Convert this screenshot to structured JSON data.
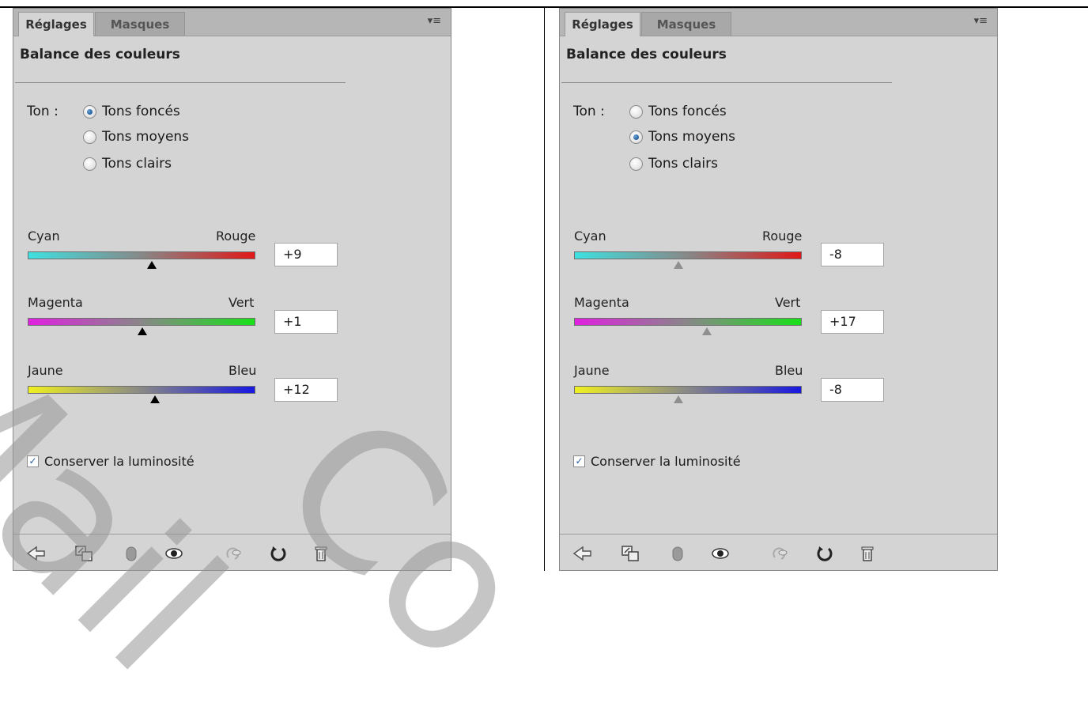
{
  "panels": [
    {
      "tabs": {
        "active": "Réglages",
        "inactive": "Masques"
      },
      "title": "Balance des couleurs",
      "ton_label": "Ton :",
      "radio_options": [
        "Tons foncés",
        "Tons moyens",
        "Tons clairs"
      ],
      "selected_radio": "Tons foncés",
      "sliders": [
        {
          "left": "Cyan",
          "right": "Rouge",
          "value": "+9",
          "level": 9,
          "from": "#3ee0e0",
          "to": "#e01818",
          "thumb": "black"
        },
        {
          "left": "Magenta",
          "right": "Vert",
          "value": "+1",
          "level": 1,
          "from": "#e020e0",
          "to": "#18e018",
          "thumb": "black"
        },
        {
          "left": "Jaune",
          "right": "Bleu",
          "value": "+12",
          "level": 12,
          "from": "#f0f020",
          "to": "#1818e0",
          "thumb": "black"
        }
      ],
      "checkbox_label": "Conserver la luminosité",
      "checkbox_checked": true,
      "panel_menu_icon": "▾≡"
    },
    {
      "tabs": {
        "active": "Réglages",
        "inactive": "Masques"
      },
      "title": "Balance des couleurs",
      "ton_label": "Ton :",
      "radio_options": [
        "Tons foncés",
        "Tons moyens",
        "Tons clairs"
      ],
      "selected_radio": "Tons moyens",
      "sliders": [
        {
          "left": "Cyan",
          "right": "Rouge",
          "value": "-8",
          "level": -8,
          "from": "#3ee0e0",
          "to": "#e01818",
          "thumb": "gray"
        },
        {
          "left": "Magenta",
          "right": "Vert",
          "value": "+17",
          "level": 17,
          "from": "#e020e0",
          "to": "#18e018",
          "thumb": "gray"
        },
        {
          "left": "Jaune",
          "right": "Bleu",
          "value": "-8",
          "level": -8,
          "from": "#f0f020",
          "to": "#1818e0",
          "thumb": "gray"
        }
      ],
      "checkbox_label": "Conserver la luminosité",
      "checkbox_checked": true,
      "panel_menu_icon": "▾≡"
    }
  ],
  "slider_range": [
    -100,
    100
  ],
  "toolbar_icons": [
    "back-arrow-icon",
    "clip-layer-icon",
    "layer-visibility-gray-icon",
    "eye-icon",
    "previous-state-icon",
    "reset-icon",
    "trash-icon"
  ],
  "watermark": {
    "first": "Mail",
    "second": "Co"
  }
}
